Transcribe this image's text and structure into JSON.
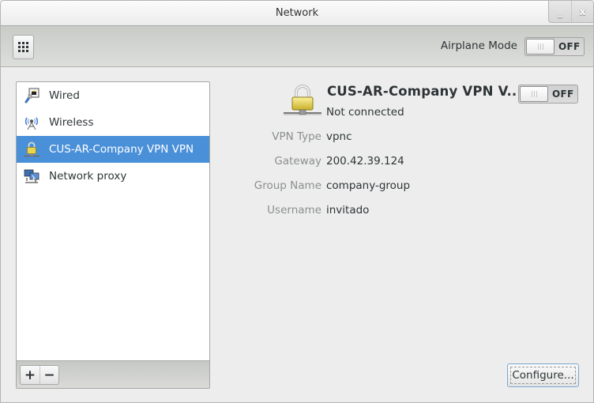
{
  "window": {
    "title": "Network",
    "minimize_label": "_",
    "close_label": "x"
  },
  "toolbar": {
    "airplane_mode_label": "Airplane Mode",
    "airplane_mode_state": "OFF",
    "airplane_mode_on": false
  },
  "sidebar": {
    "items": [
      {
        "label": "Wired",
        "icon": "wired-network-icon",
        "selected": false
      },
      {
        "label": "Wireless",
        "icon": "wireless-network-icon",
        "selected": false
      },
      {
        "label": "CUS-AR-Company VPN VPN",
        "icon": "vpn-lock-icon",
        "selected": true
      },
      {
        "label": "Network proxy",
        "icon": "network-proxy-icon",
        "selected": false
      }
    ],
    "add_label": "+",
    "remove_label": "−"
  },
  "detail": {
    "connection_name": "CUS-AR-Company VPN V...",
    "status": "Not connected",
    "switch_state": "OFF",
    "switch_on": false,
    "properties": [
      {
        "label": "VPN Type",
        "value": "vpnc"
      },
      {
        "label": "Gateway",
        "value": "200.42.39.124"
      },
      {
        "label": "Group Name",
        "value": "company-group"
      },
      {
        "label": "Username",
        "value": "invitado"
      }
    ],
    "configure_label": "Configure..."
  },
  "colors": {
    "selection": "#4a90d9",
    "lock_gold": "#e8d44d"
  }
}
